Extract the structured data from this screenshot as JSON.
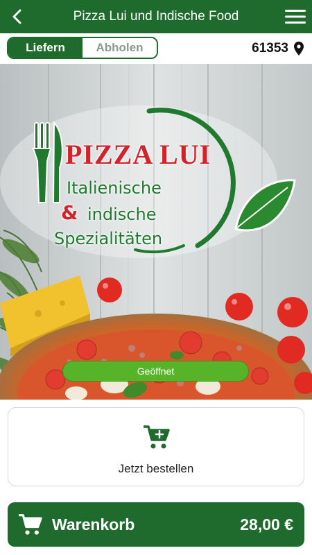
{
  "header": {
    "title": "Pizza Lui und Indische Food",
    "back_icon": "chevron-left-icon",
    "menu_icon": "hamburger-menu-icon"
  },
  "mode": {
    "deliver_label": "Liefern",
    "pickup_label": "Abholen",
    "selected": "Liefern"
  },
  "location": {
    "zip": "61353",
    "icon": "location-pin-icon"
  },
  "hero": {
    "logo_title": "PIZZA LUI",
    "logo_line1": "Italienische",
    "logo_amp": "&",
    "logo_line2": "indische",
    "logo_line3": "Spezialitäten",
    "status": "Geöffnet"
  },
  "order": {
    "label": "Jetzt bestellen",
    "icon": "cart-icon"
  },
  "cart": {
    "label": "Warenkorb",
    "total": "28,00 €",
    "icon": "cart-icon"
  },
  "colors": {
    "brand_green": "#1f6b2e",
    "status_green": "#57b428",
    "logo_red": "#d2222a"
  }
}
